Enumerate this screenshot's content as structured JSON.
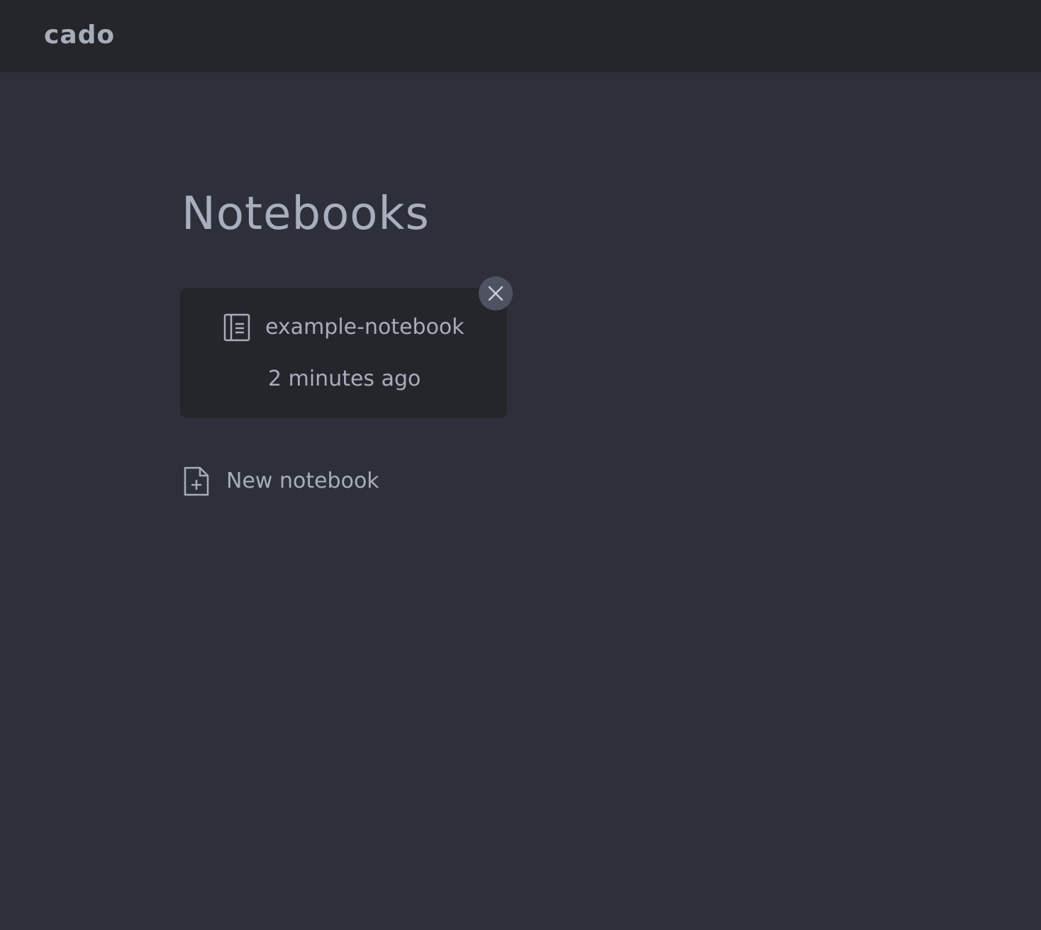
{
  "header": {
    "brand": "cado"
  },
  "main": {
    "title": "Notebooks",
    "notebooks": [
      {
        "name": "example-notebook",
        "updated": "2 minutes ago",
        "icon": "notebook-icon"
      }
    ],
    "new_notebook_label": "New notebook",
    "new_notebook_icon": "file-plus-icon",
    "close_icon": "close-icon"
  },
  "colors": {
    "background": "#2d303a",
    "header_bg": "#24262c",
    "card_bg": "#24262c",
    "close_button_bg": "#4e5362",
    "text": "#a8adba"
  }
}
